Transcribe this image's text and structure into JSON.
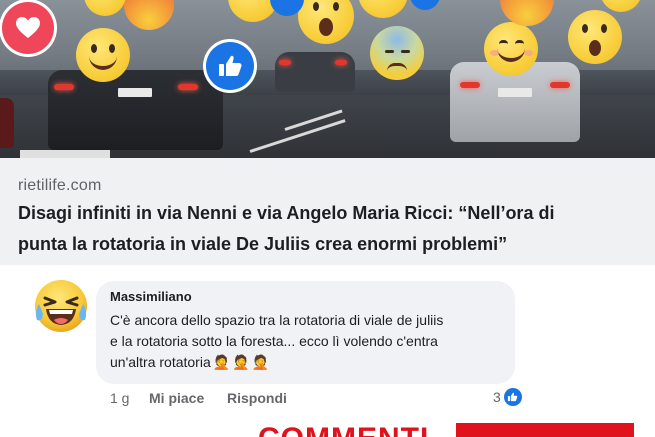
{
  "post": {
    "domain": "rietilife.com",
    "headline_line1": "Disagi infiniti in via Nenni e via Angelo Maria Ricci: “Nell’ora di",
    "headline_line2": "punta la rotatoria in viale De Juliis crea enormi problemi”"
  },
  "hero": {
    "reactions": [
      "heart",
      "like",
      "smile",
      "wow",
      "sad",
      "angry"
    ]
  },
  "comment": {
    "author": "Massimiliano",
    "text_line1": "C'è ancora dello spazio tra la rotatoria di viale de juliis",
    "text_line2": "e la rotatoria sotto la foresta... ecco lì volendo c'entra",
    "text_line3": "un'altra rotatoria",
    "inline_emojis": [
      "🤦",
      "🤦",
      "🤦"
    ],
    "avatar_emoji": "😂",
    "time": "1 g",
    "like_label": "Mi piace",
    "reply_label": "Rispondi",
    "reaction_count": "3"
  },
  "banner": {
    "text": "COMMENTI"
  },
  "colors": {
    "facebook_blue": "#1b74e4",
    "heart_red": "#f0465a",
    "banner_red": "#e0121b",
    "bubble_gray": "#f0f2f5"
  }
}
